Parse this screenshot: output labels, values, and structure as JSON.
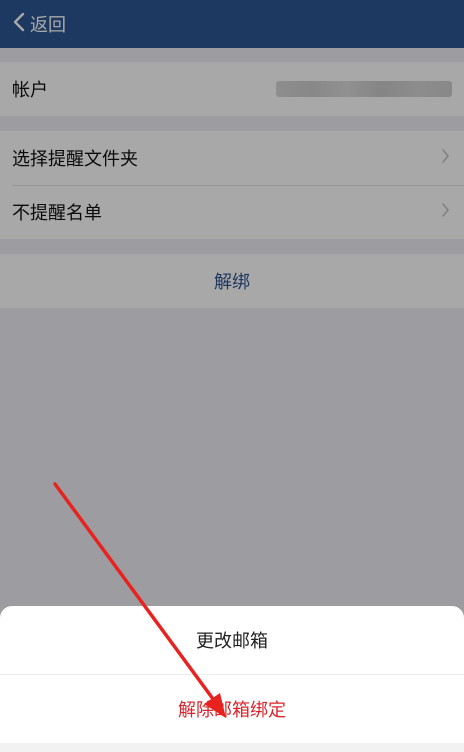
{
  "nav": {
    "back_label": "返回"
  },
  "account": {
    "label": "帐户"
  },
  "settings": {
    "items": [
      {
        "label": "选择提醒文件夹"
      },
      {
        "label": "不提醒名单"
      }
    ]
  },
  "unbind": {
    "label": "解绑"
  },
  "action_sheet": {
    "change_label": "更改邮箱",
    "unbind_label": "解除邮箱绑定"
  },
  "colors": {
    "nav": "#2e5793",
    "link": "#2e5793",
    "destructive": "#d9252b",
    "arrow": "#e8231f"
  },
  "icons": {
    "back": "chevron-left-icon",
    "row": "chevron-right-icon"
  }
}
